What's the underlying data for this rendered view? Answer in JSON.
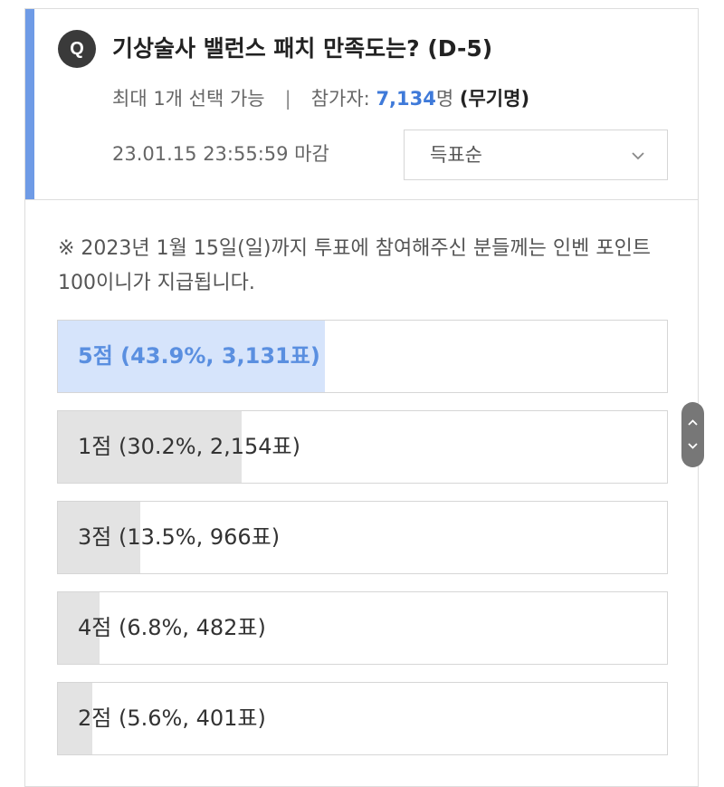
{
  "poll": {
    "badge": "Q",
    "title": "기상술사 밸런스 패치 만족도는? (D-5)",
    "selection_rule": "최대 1개 선택 가능",
    "separator": "|",
    "participants_label": "참가자: ",
    "participants_count": "7,134",
    "participants_unit": "명",
    "anonymity": "(무기명)",
    "deadline": "23.01.15 23:55:59 마감",
    "sort": {
      "selected": "득표순"
    },
    "notice": "※ 2023년 1월 15일(일)까지 투표에 참여해주신 분들께는 인벤 포인트 100이니가 지급됩니다."
  },
  "options": [
    {
      "label": "5점 (43.9%, 3,131표)",
      "percent": 43.9,
      "votes": 3131,
      "leading": true
    },
    {
      "label": "1점 (30.2%, 2,154표)",
      "percent": 30.2,
      "votes": 2154,
      "leading": false
    },
    {
      "label": "3점 (13.5%, 966표)",
      "percent": 13.5,
      "votes": 966,
      "leading": false
    },
    {
      "label": "4점 (6.8%, 482표)",
      "percent": 6.8,
      "votes": 482,
      "leading": false
    },
    {
      "label": "2점 (5.6%, 401표)",
      "percent": 5.6,
      "votes": 401,
      "leading": false
    }
  ],
  "colors": {
    "accent": "#6f9be6",
    "leading_fill": "#d6e4fb",
    "leading_text": "#5a8fe0",
    "count_text": "#3f7ad9",
    "bar_fill": "#e3e3e3"
  },
  "icons": {
    "badge": "q-badge-icon",
    "sort": "chevron-down-icon",
    "scroll_up": "chevron-up-icon",
    "scroll_down": "chevron-down-icon"
  }
}
